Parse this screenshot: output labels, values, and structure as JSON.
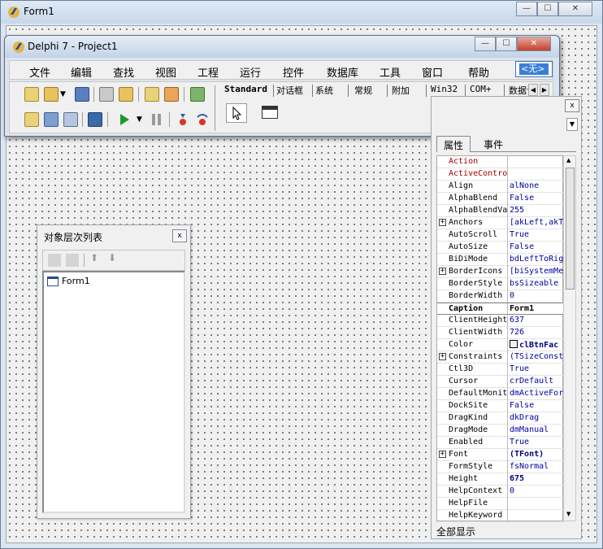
{
  "form1": {
    "title": "Form1",
    "buttons": {
      "minimize": "—",
      "maximize": "☐",
      "close": "✕"
    }
  },
  "delphi": {
    "title": "Delphi 7 - Project1",
    "buttons": {
      "minimize": "—",
      "maximize": "☐",
      "close": "✕"
    },
    "menu": [
      "文件",
      "编辑",
      "查找",
      "视图",
      "工程",
      "运行",
      "控件",
      "数据库",
      "工具",
      "窗口",
      "帮助"
    ],
    "palette_box": "<无>",
    "tabs": [
      "Standard",
      "对话框",
      "系统",
      "常规",
      "附加",
      "Win32",
      "COM+",
      "数据访"
    ]
  },
  "object_tree": {
    "title": "对象层次列表",
    "close": "x",
    "node": "Form1"
  },
  "inspector": {
    "close": "x",
    "tabs": [
      "属性",
      "事件"
    ],
    "footer": "全部显示",
    "properties": [
      {
        "name": "Action",
        "value": "",
        "style": "red"
      },
      {
        "name": "ActiveContro",
        "value": "",
        "style": "red"
      },
      {
        "name": "Align",
        "value": "alNone"
      },
      {
        "name": "AlphaBlend",
        "value": "False"
      },
      {
        "name": "AlphaBlendVa",
        "value": "255"
      },
      {
        "name": "Anchors",
        "value": "[akLeft,akT",
        "expandable": true
      },
      {
        "name": "AutoScroll",
        "value": "True"
      },
      {
        "name": "AutoSize",
        "value": "False"
      },
      {
        "name": "BiDiMode",
        "value": "bdLeftToRig"
      },
      {
        "name": "BorderIcons",
        "value": "[biSystemMe",
        "expandable": true
      },
      {
        "name": "BorderStyle",
        "value": "bsSizeable"
      },
      {
        "name": "BorderWidth",
        "value": "0"
      },
      {
        "name": "Caption",
        "value": "Form1",
        "style": "sel"
      },
      {
        "name": "ClientHeight",
        "value": "637"
      },
      {
        "name": "ClientWidth",
        "value": "726"
      },
      {
        "name": "Color",
        "value": "clBtnFac",
        "style": "bold",
        "swatch": true
      },
      {
        "name": "Constraints",
        "value": "(TSizeConst",
        "expandable": true
      },
      {
        "name": "Ctl3D",
        "value": "True"
      },
      {
        "name": "Cursor",
        "value": "crDefault"
      },
      {
        "name": "DefaultMonit",
        "value": "dmActiveForm"
      },
      {
        "name": "DockSite",
        "value": "False"
      },
      {
        "name": "DragKind",
        "value": "dkDrag"
      },
      {
        "name": "DragMode",
        "value": "dmManual"
      },
      {
        "name": "Enabled",
        "value": "True"
      },
      {
        "name": "Font",
        "value": "(TFont)",
        "expandable": true,
        "style": "bold"
      },
      {
        "name": "FormStyle",
        "value": "fsNormal"
      },
      {
        "name": "Height",
        "value": "675",
        "style": "bold"
      },
      {
        "name": "HelpContext",
        "value": "0"
      },
      {
        "name": "HelpFile",
        "value": ""
      },
      {
        "name": "HelpKeyword",
        "value": ""
      }
    ]
  }
}
